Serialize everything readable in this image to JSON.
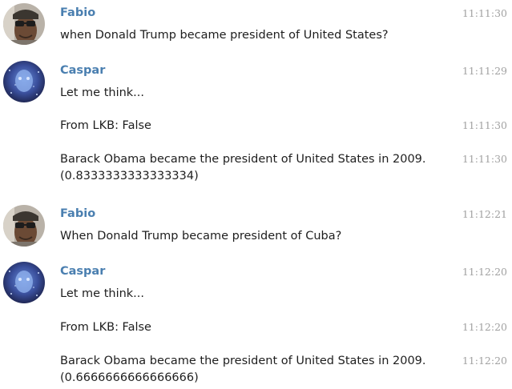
{
  "messages": [
    {
      "sender": "Fabio",
      "text": "when Donald Trump became president of United States?",
      "time": "11:11:30"
    },
    {
      "sender": "Caspar",
      "text": "Let me think...",
      "time": "11:11:29"
    },
    {
      "text": "From LKB: False",
      "time": "11:11:30"
    },
    {
      "text": "Barack Obama became the president of United States in 2009.\n(0.8333333333333334)",
      "time": "11:11:30"
    },
    {
      "sender": "Fabio",
      "text": "When Donald Trump became president of Cuba?",
      "time": "11:12:21"
    },
    {
      "sender": "Caspar",
      "text": "Let me think...",
      "time": "11:12:20"
    },
    {
      "text": "From LKB: False",
      "time": "11:12:20"
    },
    {
      "text": "Barack Obama became the president of United States in 2009.\n(0.6666666666666666)",
      "time": "11:12:20"
    }
  ],
  "colors": {
    "sender": "#4a7fb0",
    "time": "#a2a2a2",
    "text": "#1e1e1e"
  },
  "icons": {
    "fabio_avatar": "photo-avatar-man-sunglasses",
    "caspar_avatar": "photo-avatar-blue-robot-face"
  }
}
